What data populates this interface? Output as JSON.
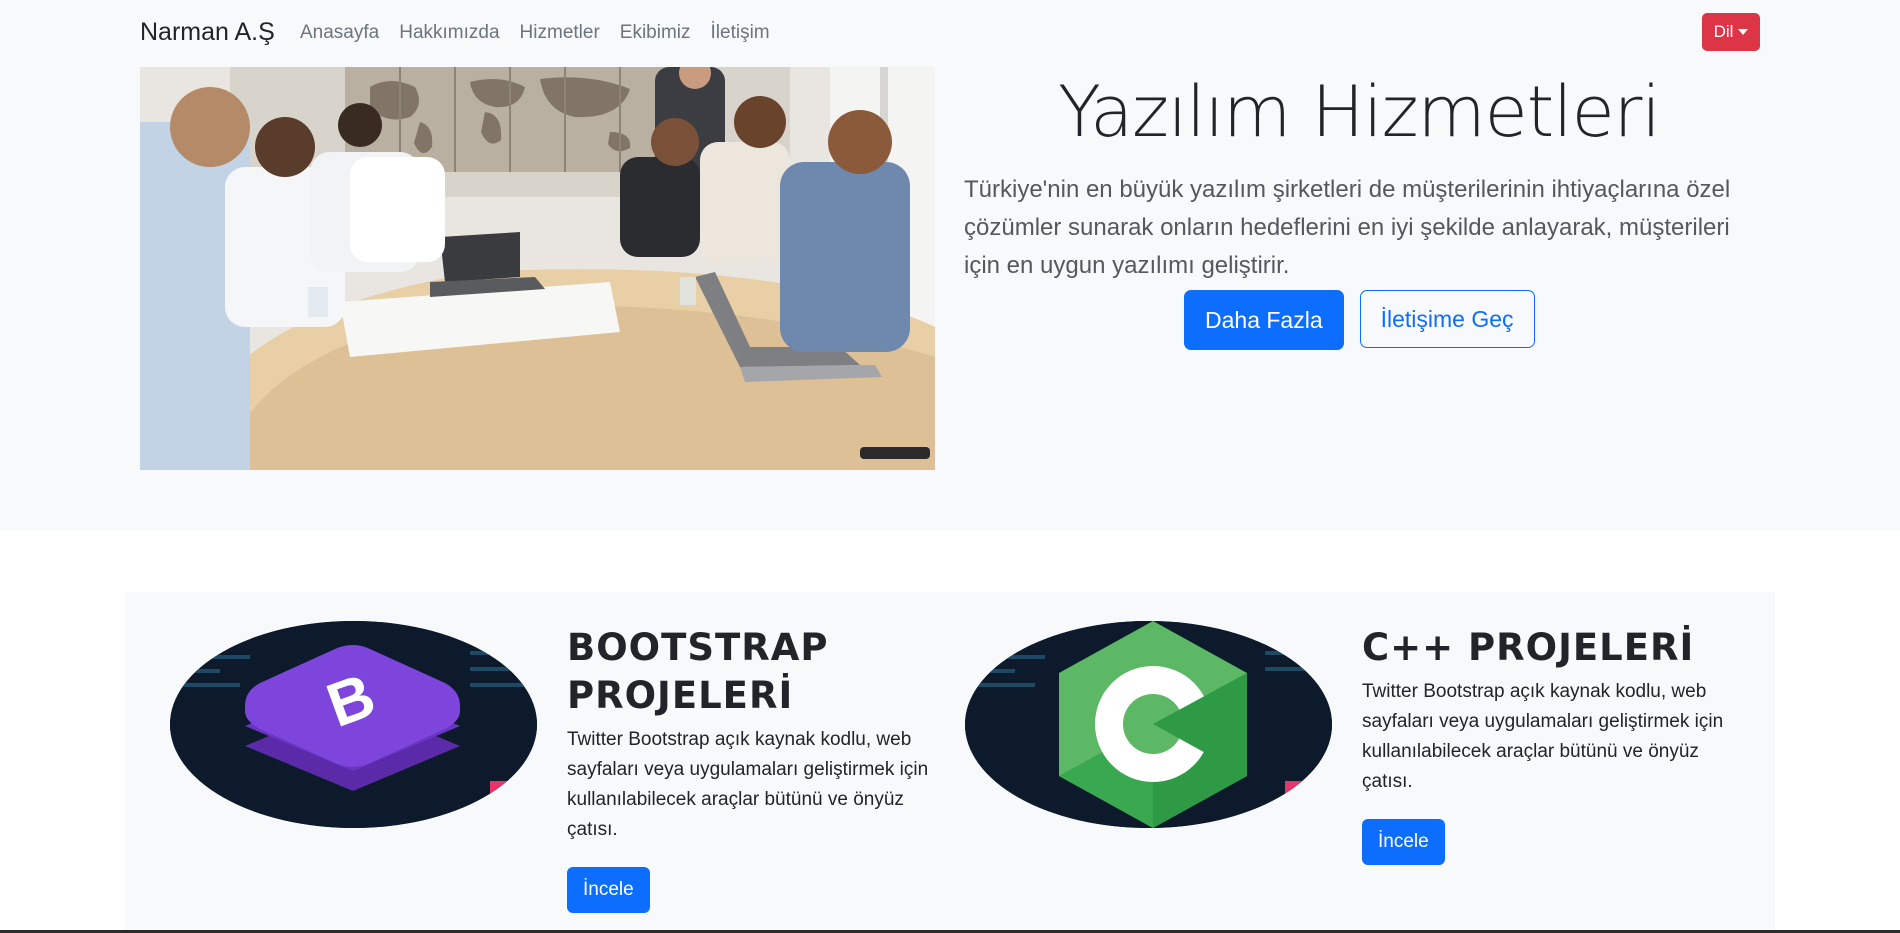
{
  "navbar": {
    "brand": "Narman A.Ş",
    "links": [
      "Anasayfa",
      "Hakkımızda",
      "Hizmetler",
      "Ekibimiz",
      "İletişim"
    ],
    "lang_button": "Dil"
  },
  "hero": {
    "title": "Yazılım Hizmetleri",
    "lead": "Türkiye'nin en büyük yazılım şirketleri de müşterilerinin ihtiyaçlarına özel çözümler sunarak onların hedeflerini en iyi şekilde anlayarak, müşterileri için en uygun yazılımı geliştirir.",
    "primary_button": "Daha Fazla",
    "secondary_button": "İletişime Geç"
  },
  "projects": [
    {
      "title": "BOOTSTRAP PROJELERİ",
      "description": "Twitter Bootstrap açık kaynak kodlu, web sayfaları veya uygulamaları geliştirmek için kullanılabilecek araçlar bütünü ve önyüz çatısı.",
      "button": "İncele"
    },
    {
      "title": "C++ PROJELERİ",
      "description": "Twitter Bootstrap açık kaynak kodlu, web sayfaları veya uygulamaları geliştirmek için kullanılabilecek araçlar bütünü ve önyüz çatısı.",
      "button": "İncele"
    }
  ],
  "colors": {
    "primary": "#0d6efd",
    "danger": "#dc3545",
    "light_bg": "#f8f9fa"
  }
}
